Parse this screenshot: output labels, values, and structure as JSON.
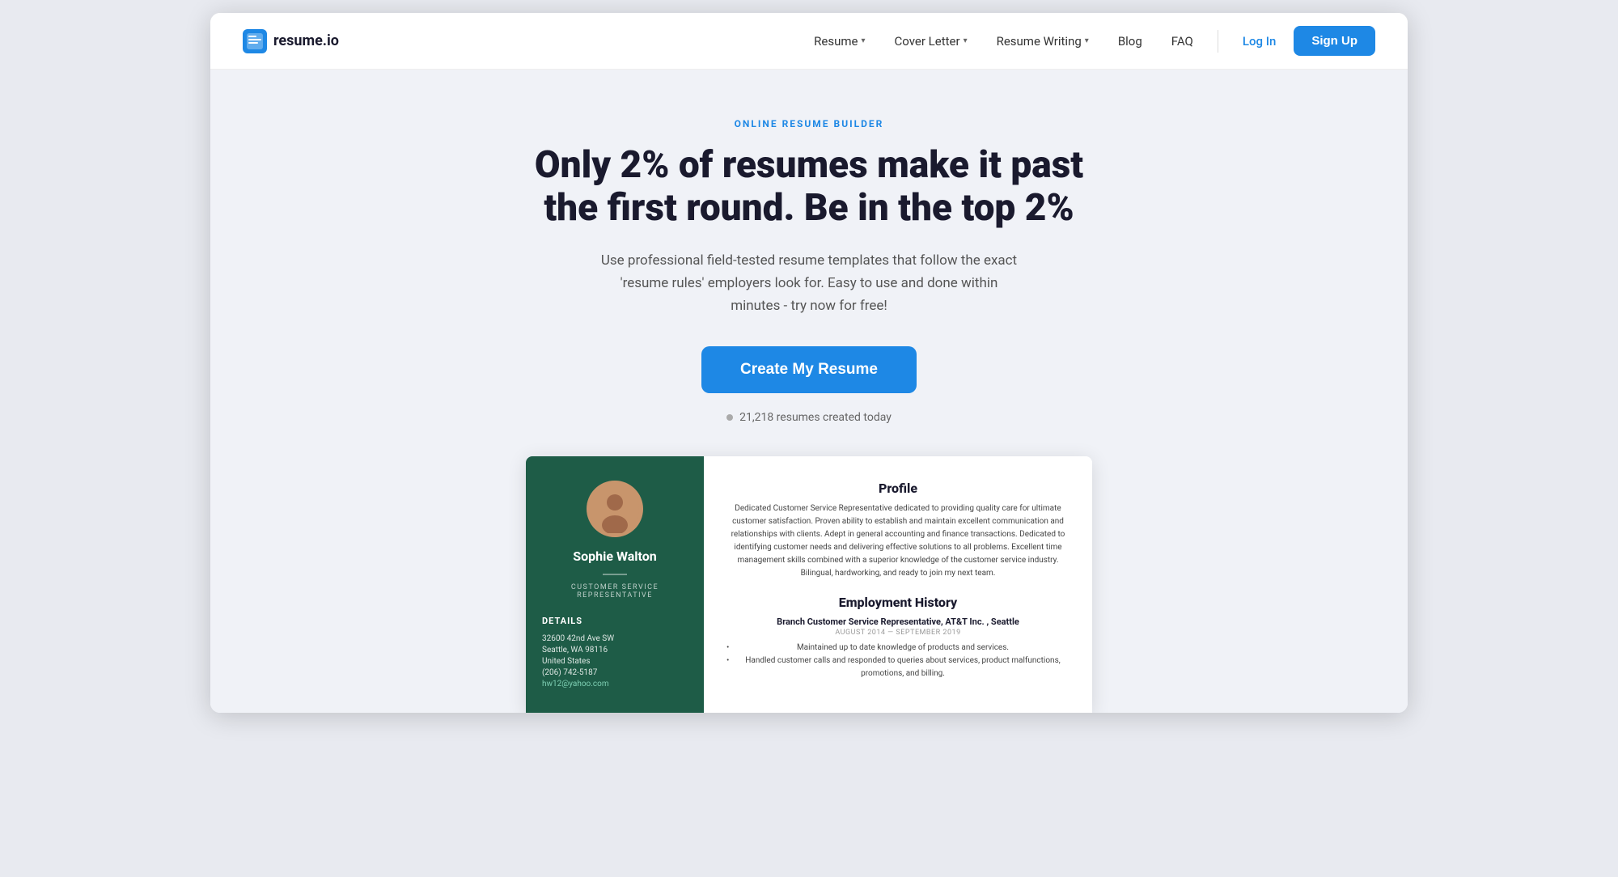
{
  "brand": {
    "logo_text": "resume.io",
    "logo_icon": "R"
  },
  "navbar": {
    "links": [
      {
        "label": "Resume",
        "has_dropdown": true
      },
      {
        "label": "Cover Letter",
        "has_dropdown": true
      },
      {
        "label": "Resume Writing",
        "has_dropdown": true
      },
      {
        "label": "Blog",
        "has_dropdown": false
      },
      {
        "label": "FAQ",
        "has_dropdown": false
      }
    ],
    "login_label": "Log In",
    "signup_label": "Sign Up"
  },
  "hero": {
    "eyebrow": "ONLINE RESUME BUILDER",
    "title": "Only 2% of resumes make it past the first round. Be in the top 2%",
    "subtitle": "Use professional field-tested resume templates that follow the exact 'resume rules' employers look for. Easy to use and done within minutes - try now for free!",
    "cta_label": "Create My Resume",
    "stat_text": "21,218 resumes created today"
  },
  "resume_preview": {
    "left": {
      "name": "Sophie Walton",
      "job_title": "CUSTOMER SERVICE\nREPRESENTATIVE",
      "details_label": "Details",
      "address_line1": "32600 42nd Ave SW",
      "address_line2": "Seattle, WA 98116",
      "country": "United States",
      "phone": "(206) 742-5187",
      "email": "hw12@yahoo.com"
    },
    "right": {
      "profile_title": "Profile",
      "profile_text": "Dedicated Customer Service Representative dedicated to providing quality care for ultimate customer satisfaction. Proven ability to establish and maintain excellent communication and relationships with clients. Adept in general accounting and finance transactions. Dedicated to identifying customer needs and delivering effective solutions to all problems. Excellent time management skills combined with a superior knowledge of the customer service industry. Bilingual, hardworking, and ready to join my next team.",
      "employment_title": "Employment History",
      "job1_title": "Branch Customer Service Representative, AT&T Inc. , Seattle",
      "job1_dates": "AUGUST 2014 — SEPTEMBER 2019",
      "job1_bullets": [
        "Maintained up to date knowledge of products and services.",
        "Handled customer calls and responded to queries about services, product malfunctions, promotions, and billing."
      ]
    }
  }
}
